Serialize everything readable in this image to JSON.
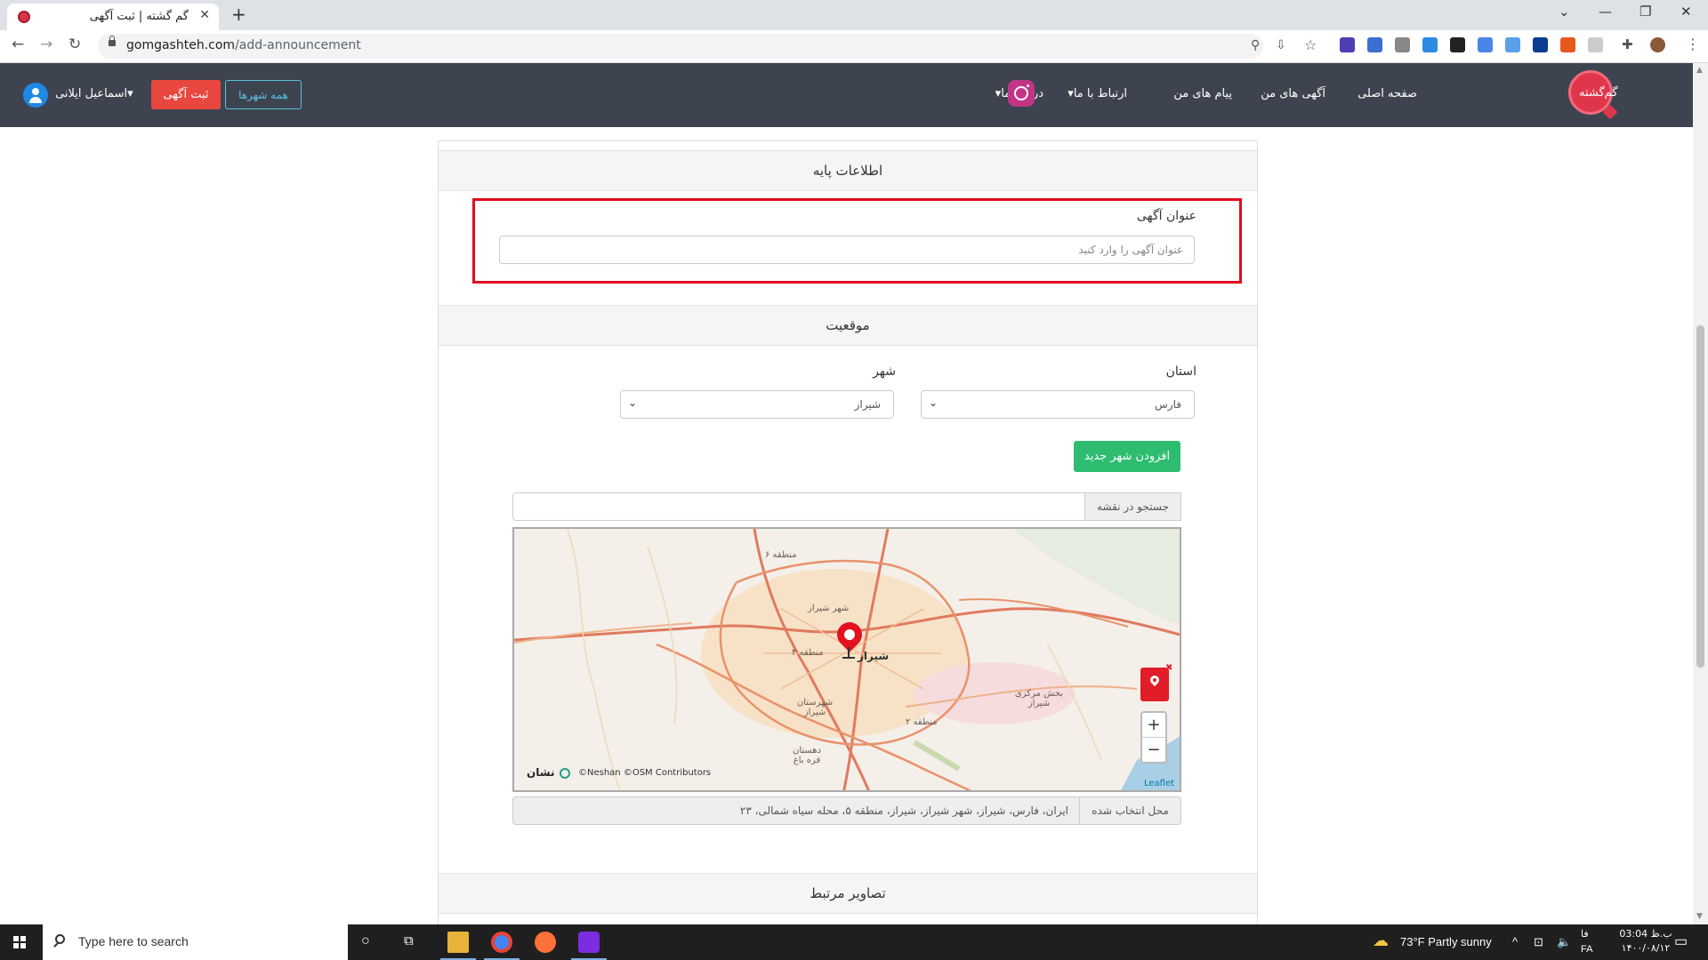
{
  "browser": {
    "tab_title": "گم گشته | ثبت آگهی",
    "url_host": "gomgashteh.com",
    "url_path": "/add-announcement",
    "new_tab": "+"
  },
  "nav": {
    "home": "صفحه اصلی",
    "my_ads": "آگهی های من",
    "my_messages": "پیام های من",
    "contact": "ارتباط با ما",
    "about": "درباره ما",
    "all_cities": "همه شهرها",
    "submit_ad": "ثبت آگهی",
    "user_name": "اسماعیل ایلانی",
    "logo_text": "گم‌گشته"
  },
  "form": {
    "basic_section": "اطلاعات پایه",
    "title_label": "عنوان آگهی",
    "title_placeholder": "عنوان آگهی را وارد کنید",
    "location_section": "موقعیت",
    "province_label": "استان",
    "province_value": "فارس",
    "city_label": "شهر",
    "city_value": "شیراز",
    "add_city_button": "افزودن شهر جدید",
    "map_search_label": "جستجو در نقشه",
    "selected_label": "محل انتخاب شده",
    "selected_value": "ایران، فارس، شیراز، شهر شیراز، شیراز، منطقه ۵، محله سیاه شمالی، ۲۳",
    "images_section": "تصاویر مرتبط"
  },
  "map": {
    "city_label": "شیراز",
    "labels": [
      "منطقه ۶",
      "شهر شیراز",
      "منطقه ۴",
      "شهرستان شیراز",
      "منطقه ۲",
      "دهستان فره باغ",
      "بخش مرکزی شیراز"
    ],
    "attribution": "©Neshan ©OSM Contributors",
    "brand": "نشان",
    "leaflet": "Leaflet",
    "zoom_in": "+",
    "zoom_out": "−"
  },
  "taskbar": {
    "search_placeholder": "Type here to search",
    "weather": "73°F  Partly sunny",
    "lang": "FA",
    "lang_short": "فا",
    "time": "03:04 ب.ظ",
    "date": "۱۴۰۰/۰۸/۱۲"
  },
  "colors": {
    "nav_bg": "#3d4450",
    "accent_red": "#e8473f",
    "accent_green": "#2ebd70",
    "highlight_box": "#e10a1e"
  }
}
